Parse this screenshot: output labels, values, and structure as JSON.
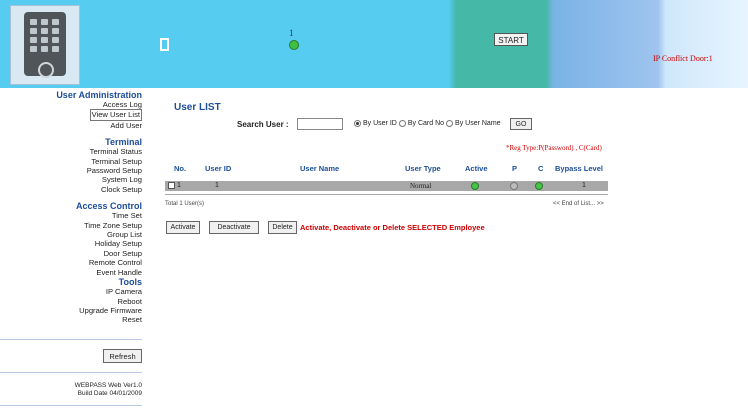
{
  "header": {
    "door_number": "1",
    "start_label": "START",
    "ip_conflict_text": "IP Conflict Door:1"
  },
  "sidebar": {
    "user_admin_title": "User Administration",
    "user_admin_items": [
      "Access Log",
      "View User List",
      "Add User"
    ],
    "terminal_title": "Terminal",
    "terminal_items": [
      "Terminal Status",
      "Terminal Setup",
      "Password Setup",
      "System Log",
      "Clock Setup"
    ],
    "access_control_title": "Access Control",
    "access_control_items": [
      "Time Set",
      "Time Zone Setup",
      "Group List",
      "Holiday Setup",
      "Door Setup",
      "Remote Control",
      "Event Handle"
    ],
    "tools_title": "Tools",
    "tools_items": [
      "IP Camera",
      "Reboot",
      "Upgrade Firmware",
      "Reset"
    ],
    "refresh_label": "Refresh",
    "version": "WEBPASS Web Ver1.0",
    "build_date": "Build Date 04/01/2009"
  },
  "main": {
    "title": "User LIST",
    "search_label": "Search User :",
    "search_value": "",
    "radio_options": [
      "By User ID",
      "By Card No",
      "By User Name"
    ],
    "go_label": "GO",
    "reg_type_note": "*Reg Type:P(Password) , C(Card)",
    "columns": [
      "No.",
      "User ID",
      "User Name",
      "User Type",
      "Active",
      "P",
      "C",
      "Bypass Level"
    ],
    "rows": [
      {
        "no": "1",
        "user_id": "1",
        "user_name": "",
        "user_type": "Normal",
        "bypass": "1"
      }
    ],
    "total_text": "Total 1 User(s)",
    "end_of_list": "<< End of List... >>",
    "activate_label": "Activate",
    "deactivate_label": "Deactivate",
    "delete_label": "Delete",
    "action_text": "Activate, Deactivate or Delete SELECTED Employee"
  },
  "colors": {
    "header_bg": "#55ccf0",
    "nav_title": "#1c4e9a",
    "alert_red": "#cc0000",
    "status_green": "#46c646"
  }
}
